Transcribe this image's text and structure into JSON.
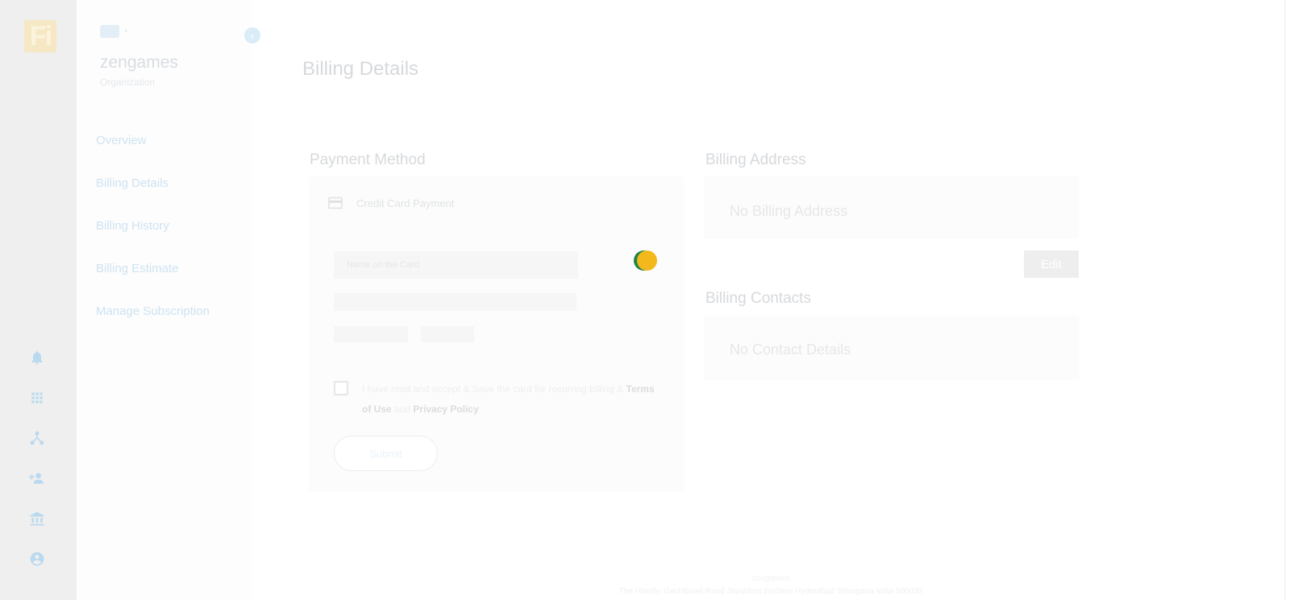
{
  "app": {
    "logo_text": "Fi"
  },
  "sidebar": {
    "org_name": "zengames",
    "org_subtitle": "Organization",
    "collapse_icon": "‹",
    "items": [
      {
        "label": "Overview"
      },
      {
        "label": "Billing Details"
      },
      {
        "label": "Billing History"
      },
      {
        "label": "Billing Estimate"
      },
      {
        "label": "Manage Subscription"
      }
    ]
  },
  "rail_icons": [
    "bell-icon",
    "apps-grid-icon",
    "hierarchy-icon",
    "add-user-icon",
    "bank-icon",
    "account-circle-icon"
  ],
  "main": {
    "page_title": "Billing Details",
    "payment": {
      "section_title": "Payment Method",
      "payment_type": "Credit Card Payment",
      "name_placeholder": "Name on the Card",
      "consent_prefix": "I have read and accept & Save the card for recurring billing & ",
      "terms_link": "Terms of Use",
      "consent_and": " and ",
      "privacy_link": "Privacy Policy",
      "submit_label": "Submit"
    },
    "billing_address": {
      "section_title": "Billing Address",
      "empty_text": "No Billing Address",
      "edit_label": "Edit"
    },
    "billing_contacts": {
      "section_title": "Billing Contacts",
      "empty_text": "No Contact Details"
    }
  },
  "footer": {
    "company": "zengames",
    "address": "The Hilarity, Gachibowli Road Jayabheri Enclave Hyderabad Telangana India 500032"
  },
  "colors": {
    "accent": "#1b8dd6",
    "spinner_green": "#1e8449",
    "spinner_yellow": "#f2b81c"
  }
}
